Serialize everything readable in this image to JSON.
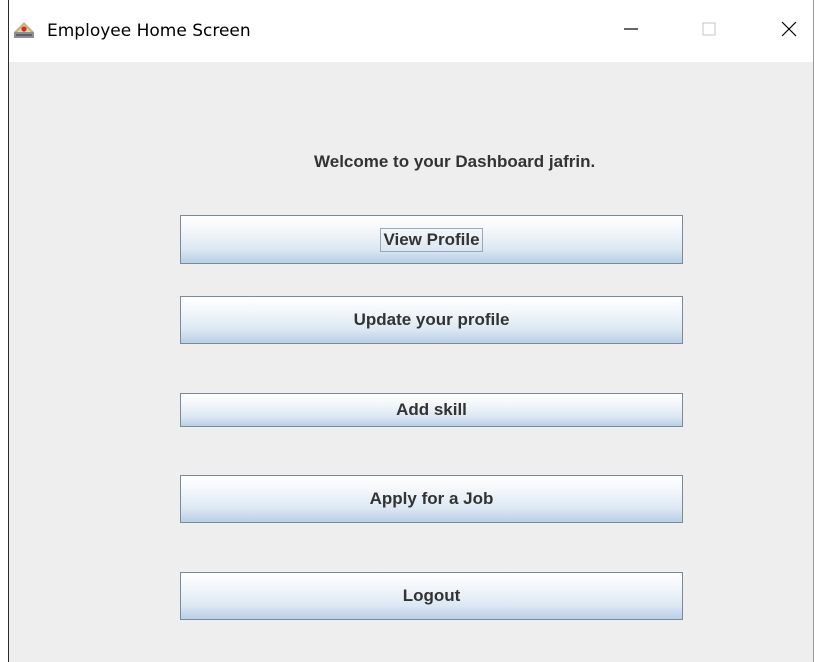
{
  "window": {
    "title": "Employee Home Screen",
    "icons": {
      "app": "java-app-icon",
      "minimize": "minimize-icon",
      "maximize": "maximize-icon",
      "close": "close-icon"
    }
  },
  "dashboard": {
    "welcome_text": "Welcome to your Dashboard jafrin.",
    "buttons": {
      "view_profile": "View Profile",
      "update_profile": "Update your profile",
      "add_skill": "Add skill",
      "apply_job": "Apply for a Job",
      "logout": "Logout"
    },
    "focused_button": "View Profile"
  },
  "colors": {
    "content_background": "#eeeeee",
    "button_border": "#7a8a99",
    "button_gradient_bottom": "#b8cfe5",
    "text": "#333333"
  }
}
